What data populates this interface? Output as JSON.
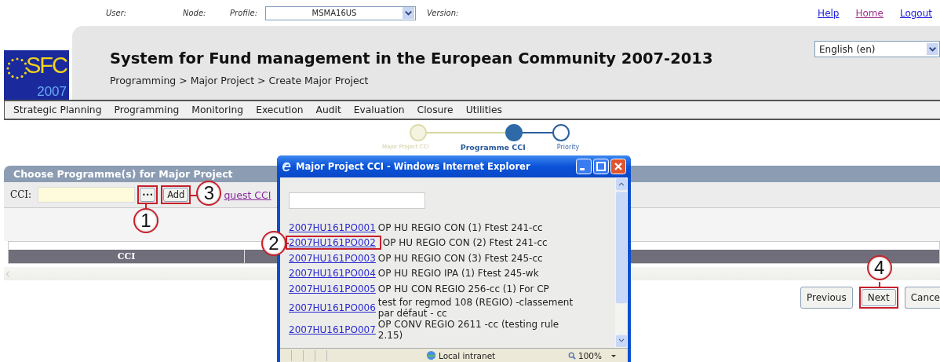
{
  "top_bar": {
    "user_label": "User:",
    "node_label": "Node:",
    "profile_label": "Profile:",
    "profile_value": "MSMA16US",
    "version_label": "Version:",
    "links": [
      {
        "label": "Help",
        "visited": false
      },
      {
        "label": "Home",
        "visited": true
      },
      {
        "label": "Logout",
        "visited": false
      }
    ]
  },
  "header": {
    "logo_text": "SFC",
    "logo_year": "2007",
    "title": "System for Fund management in the European Community 2007-2013",
    "breadcrumb": "Programming > Major Project > Create Major Project",
    "language": "English (en)"
  },
  "menu": [
    "Strategic Planning",
    "Programming",
    "Monitoring",
    "Execution",
    "Audit",
    "Evaluation",
    "Closure",
    "Utilities"
  ],
  "steps": [
    {
      "label": "Major Project CCI",
      "completed": true,
      "selected": false
    },
    {
      "label": "Programme CCI",
      "completed": false,
      "selected": true
    },
    {
      "label": "Priority",
      "completed": false,
      "selected": false
    }
  ],
  "panel": {
    "title": "Choose Programme(s) for Major Project",
    "cci_label": "CCI:",
    "browse_button": "•••",
    "add_button": "Add",
    "request_link": "quest CCI",
    "columns": [
      "CCI"
    ]
  },
  "buttons": [
    "Previous",
    "Next",
    "Cance"
  ],
  "popup": {
    "title": "Major Project CCI - Windows Internet Explorer",
    "items": [
      {
        "code": "2007HU161PO001",
        "text": "OP HU REGIO CON (1) Ftest 241-cc"
      },
      {
        "code": "2007HU161PO002",
        "text": "OP HU REGIO CON (2) Ftest 241-cc"
      },
      {
        "code": "2007HU161PO003",
        "text": "OP HU REGIO CON (3) Ftest 245-cc"
      },
      {
        "code": "2007HU161PO004",
        "text": "OP HU REGIO IPA (1) Ftest 245-wk"
      },
      {
        "code": "2007HU161PO005",
        "text": "OP HU CON REGIO 256-cc (1) For CP"
      },
      {
        "code": "2007HU161PO006",
        "text": "test for regmod 108 (REGIO) -classement par défaut - cc"
      },
      {
        "code": "2007HU161PO007",
        "text": "OP CONV REGIO 2611 -cc (testing rule 2.15)"
      }
    ],
    "zone": "Local intranet",
    "zoom": "100%"
  },
  "callouts": [
    "1",
    "2",
    "3",
    "4"
  ]
}
